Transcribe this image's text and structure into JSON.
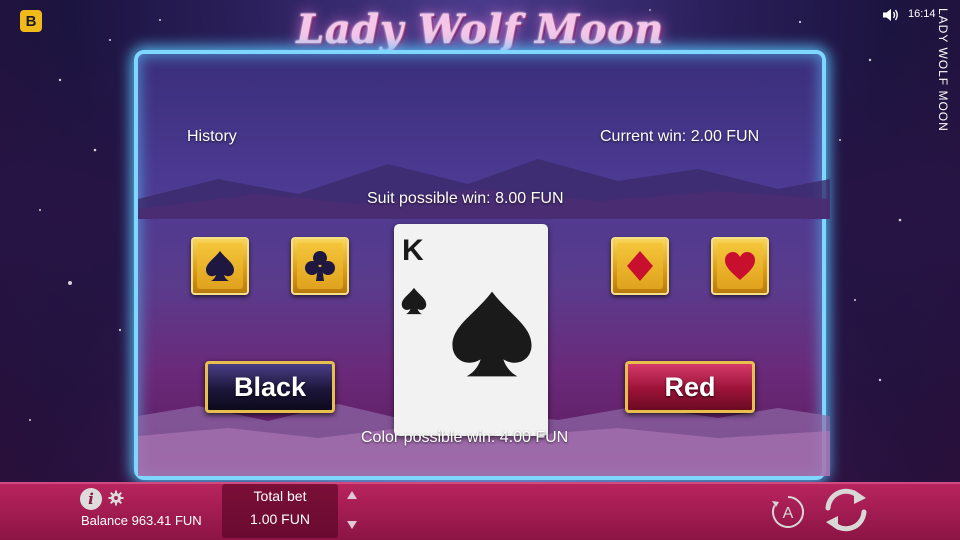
{
  "brand": {
    "logo_letter": "B"
  },
  "header": {
    "game_title": "Lady Wolf Moon",
    "time": "16:14",
    "side_title": "LADY WOLF MOON",
    "icons": [
      "sound-icon"
    ]
  },
  "gamble": {
    "history_label": "History",
    "current_win": "Current win: 2.00 FUN",
    "suit_possible_win": "Suit possible win: 8.00 FUN",
    "color_possible_win": "Color possible win: 4.00 FUN",
    "suits": [
      {
        "name": "spade",
        "color": "#1e1840"
      },
      {
        "name": "club",
        "color": "#1e1840"
      },
      {
        "name": "diamond",
        "color": "#c8102e"
      },
      {
        "name": "heart",
        "color": "#c8102e"
      }
    ],
    "card": {
      "rank": "K",
      "suit": "spade"
    },
    "black_label": "Black",
    "red_label": "Red"
  },
  "footer": {
    "balance": "Balance 963.41 FUN",
    "total_bet_label": "Total bet",
    "total_bet_value": "1.00 FUN",
    "icons": [
      "info-icon",
      "gear-icon",
      "bet-up-arrow-icon",
      "bet-down-arrow-icon",
      "autoplay-icon",
      "spin-icon"
    ]
  },
  "colors": {
    "frame_glow": "#7fd6ff",
    "gold": "#e8bf4c",
    "footer": "#a81c52",
    "logo": "#f2b91a"
  }
}
